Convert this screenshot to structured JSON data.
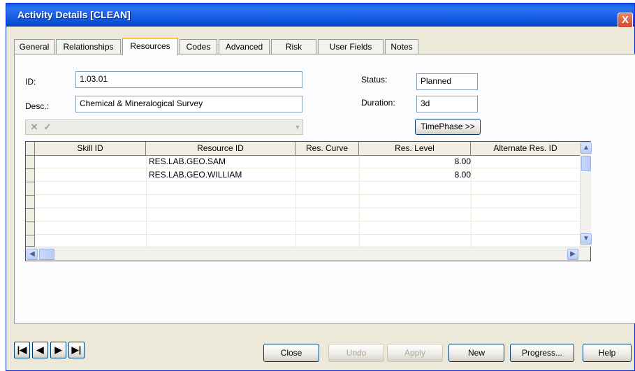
{
  "window": {
    "title": "Activity Details [CLEAN]",
    "close_glyph": "X"
  },
  "tabs": [
    "General",
    "Relationships",
    "Resources",
    "Codes",
    "Advanced",
    "Risk",
    "User Fields",
    "Notes"
  ],
  "active_tab": "Resources",
  "form": {
    "id_label": "ID:",
    "id_value": "1.03.01",
    "desc_label": "Desc.:",
    "desc_value": "Chemical & Mineralogical Survey",
    "status_label": "Status:",
    "status_value": "Planned",
    "duration_label": "Duration:",
    "duration_value": "3d",
    "timephase_label": "TimePhase >>"
  },
  "toolbar": {
    "cancel_glyph": "✕",
    "accept_glyph": "✓",
    "dropdown_glyph": "▼"
  },
  "grid": {
    "columns": [
      "Skill ID",
      "Resource ID",
      "Res. Curve",
      "Res. Level",
      "Alternate Res. ID"
    ],
    "rows": [
      {
        "skill_id": "",
        "resource_id": "RES.LAB.GEO.SAM",
        "res_curve": "",
        "res_level": "8.00",
        "alt_res_id": ""
      },
      {
        "skill_id": "",
        "resource_id": "RES.LAB.GEO.WILLIAM",
        "res_curve": "",
        "res_level": "8.00",
        "alt_res_id": ""
      }
    ],
    "scroll_up": "▲",
    "scroll_down": "▼",
    "scroll_left": "◀",
    "scroll_right": "▶"
  },
  "nav": {
    "first": "|◀",
    "prev": "◀",
    "next": "▶",
    "last": "▶|"
  },
  "buttons": {
    "close": "Close",
    "undo": "Undo",
    "apply": "Apply",
    "new": "New",
    "progress": "Progress...",
    "help": "Help"
  }
}
